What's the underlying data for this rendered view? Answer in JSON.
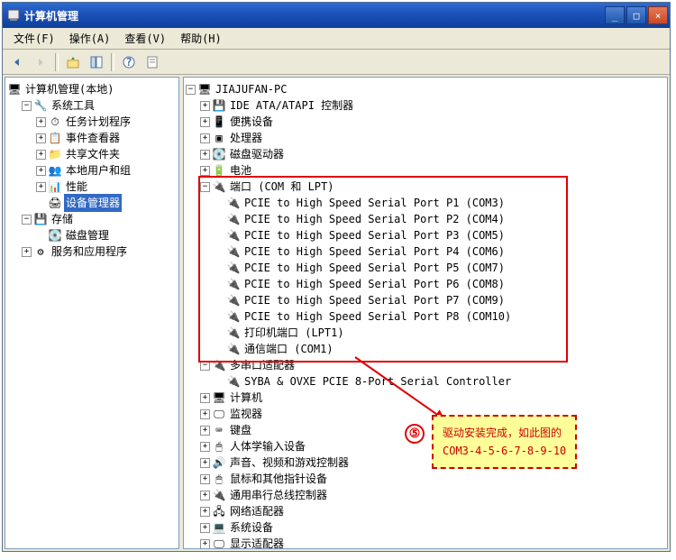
{
  "window": {
    "title": "计算机管理",
    "minimize": "_",
    "maximize": "□",
    "close": "×"
  },
  "menu": {
    "file": "文件(F)",
    "action": "操作(A)",
    "view": "查看(V)",
    "help": "帮助(H)"
  },
  "leftTree": {
    "root": "计算机管理(本地)",
    "systemTools": "系统工具",
    "taskScheduler": "任务计划程序",
    "eventViewer": "事件查看器",
    "sharedFolders": "共享文件夹",
    "localUsers": "本地用户和组",
    "performance": "性能",
    "deviceManager": "设备管理器",
    "storage": "存储",
    "diskManagement": "磁盘管理",
    "services": "服务和应用程序"
  },
  "rightTree": {
    "computer": "JIAJUFAN-PC",
    "ideAtapi": "IDE ATA/ATAPI 控制器",
    "portable": "便携设备",
    "processors": "处理器",
    "diskDrives": "磁盘驱动器",
    "battery": "电池",
    "ports": "端口 (COM 和 LPT)",
    "port1": "PCIE to High Speed Serial Port P1 (COM3)",
    "port2": "PCIE to High Speed Serial Port P2 (COM4)",
    "port3": "PCIE to High Speed Serial Port P3 (COM5)",
    "port4": "PCIE to High Speed Serial Port P4 (COM6)",
    "port5": "PCIE to High Speed Serial Port P5 (COM7)",
    "port6": "PCIE to High Speed Serial Port P6 (COM8)",
    "port7": "PCIE to High Speed Serial Port P7 (COM9)",
    "port8": "PCIE to High Speed Serial Port P8 (COM10)",
    "printerPort": "打印机端口 (LPT1)",
    "commPort": "通信端口 (COM1)",
    "multiSerial": "多串口适配器",
    "syba": "SYBA & OVXE PCIE 8-Port Serial Controller",
    "computers": "计算机",
    "monitors": "监视器",
    "keyboards": "键盘",
    "hid": "人体学输入设备",
    "soundVideo": "声音、视频和游戏控制器",
    "mice": "鼠标和其他指针设备",
    "usb": "通用串行总线控制器",
    "networkAdapters": "网络适配器",
    "systemDevices": "系统设备",
    "displayAdapters": "显示适配器"
  },
  "callout": {
    "number": "⑤",
    "line1": "驱动安装完成，如此图的",
    "line2": "COM3-4-5-6-7-8-9-10"
  }
}
